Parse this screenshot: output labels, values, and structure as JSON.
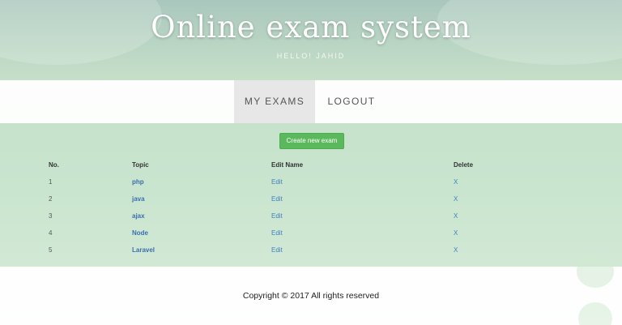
{
  "header": {
    "title": "Online exam system",
    "greeting": "HELLO! JAHID"
  },
  "nav": {
    "items": [
      {
        "label": "MY EXAMS",
        "active": true
      },
      {
        "label": "LOGOUT",
        "active": false
      }
    ]
  },
  "main": {
    "create_button_label": "Create new exam",
    "table": {
      "headers": [
        "No.",
        "Topic",
        "Edit Name",
        "Delete"
      ],
      "rows": [
        {
          "no": "1",
          "topic": "php",
          "edit": "Edit",
          "delete": "X"
        },
        {
          "no": "2",
          "topic": "java",
          "edit": "Edit",
          "delete": "X"
        },
        {
          "no": "3",
          "topic": "ajax",
          "edit": "Edit",
          "delete": "X"
        },
        {
          "no": "4",
          "topic": "Node",
          "edit": "Edit",
          "delete": "X"
        },
        {
          "no": "5",
          "topic": "Laravel",
          "edit": "Edit",
          "delete": "X"
        }
      ]
    }
  },
  "footer": {
    "copyright": "Copyright © 2017 All rights reserved"
  },
  "colors": {
    "accent_green": "#5cb85c",
    "link_blue": "#3f7fbf",
    "nav_active_bg": "#e7e7e7"
  }
}
